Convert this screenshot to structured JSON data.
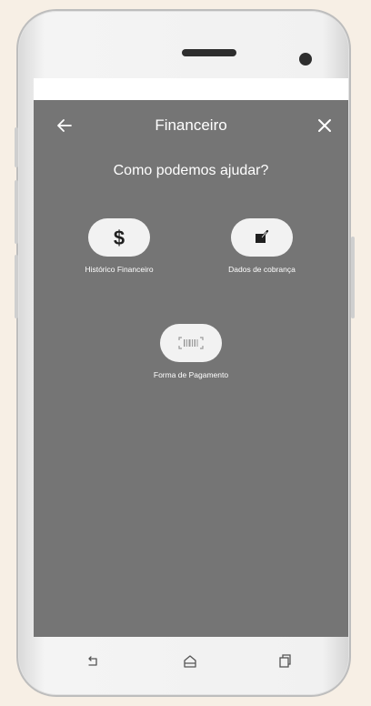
{
  "header": {
    "title": "Financeiro",
    "back_icon": "arrow-left-icon",
    "close_icon": "close-icon"
  },
  "main": {
    "question": "Como podemos ajudar?",
    "options": [
      {
        "label": "Histórico Financeiro",
        "icon": "dollar-icon"
      },
      {
        "label": "Dados de cobrança",
        "icon": "edit-note-icon"
      },
      {
        "label": "Forma de Pagamento",
        "icon": "barcode-icon"
      }
    ]
  },
  "android_nav": {
    "back_icon": "nav-back-icon",
    "home_icon": "nav-home-icon",
    "recents_icon": "nav-recents-icon"
  },
  "colors": {
    "app_background": "#757575",
    "button_fill": "#f2f2f2",
    "icon_dark": "#1f1f1f",
    "text": "#ffffff"
  }
}
